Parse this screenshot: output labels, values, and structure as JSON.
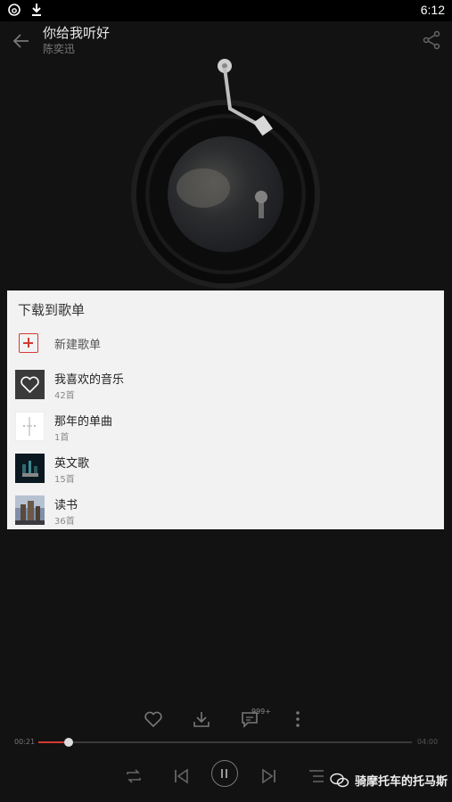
{
  "status_bar": {
    "time": "6:12"
  },
  "header": {
    "song_title": "你给我听好",
    "artist": "陈奕迅"
  },
  "dialog": {
    "title": "下载到歌单",
    "new_playlist_label": "新建歌单",
    "playlists": [
      {
        "name": "我喜欢的音乐",
        "count": "42首",
        "thumb": "heart-cover"
      },
      {
        "name": "那年的单曲",
        "count": "1首",
        "thumb": "white-cover"
      },
      {
        "name": "英文歌",
        "count": "15首",
        "thumb": "night-cover"
      },
      {
        "name": "读书",
        "count": "36首",
        "thumb": "city-cover"
      }
    ]
  },
  "player": {
    "comment_count": "999+",
    "current_time": "00:21",
    "total_time": "04:00",
    "progress": 0.08
  },
  "watermark": {
    "text": "骑摩托车的托马斯"
  },
  "colors": {
    "accent": "#d33a31",
    "dialog_bg": "#f2f2f2",
    "page_bg": "#121212"
  }
}
